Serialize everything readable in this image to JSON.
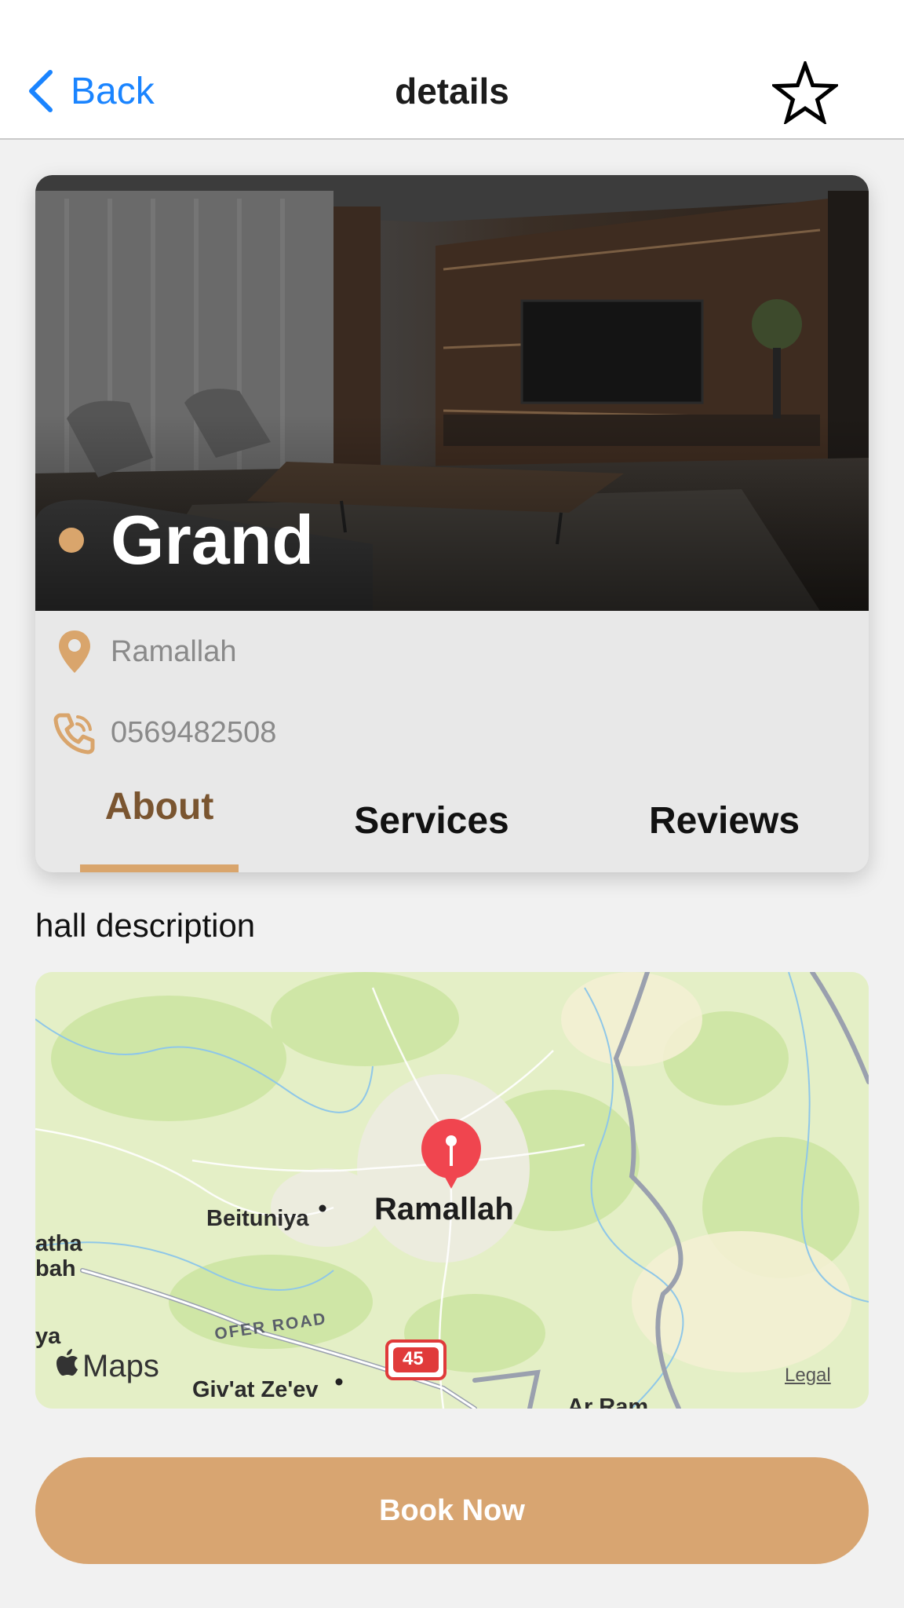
{
  "nav": {
    "back_label": "Back",
    "title": "details"
  },
  "hall": {
    "name": "Grand",
    "location": "Ramallah",
    "phone": "0569482508",
    "description": "hall description"
  },
  "tabs": [
    {
      "label": "About",
      "active": true
    },
    {
      "label": "Services",
      "active": false
    },
    {
      "label": "Reviews",
      "active": false
    }
  ],
  "map": {
    "city_label": "Ramallah",
    "places": [
      "Beituniya",
      "Giv'at Ze'ev",
      "atha",
      "bah",
      "ya",
      "Ar Ram"
    ],
    "road_label": "OFER ROAD",
    "route_number": "45",
    "brand": "Maps",
    "legal": "Legal"
  },
  "actions": {
    "book_label": "Book Now"
  },
  "colors": {
    "accent": "#d8a571",
    "tab_active": "#7a5530",
    "link_blue": "#1a84ff",
    "pin_red": "#f0454f"
  }
}
